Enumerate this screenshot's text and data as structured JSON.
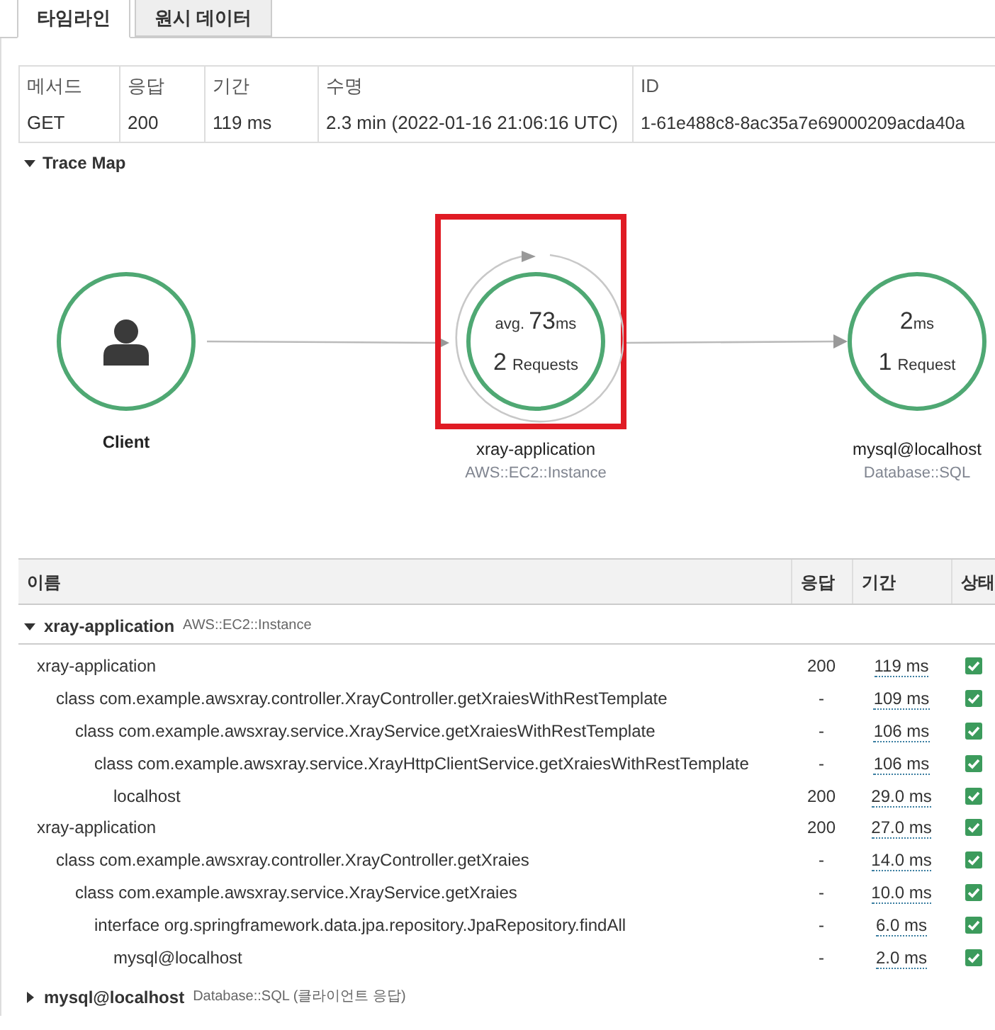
{
  "tabs": [
    {
      "label": "타임라인",
      "selected": true
    },
    {
      "label": "원시 데이터",
      "selected": false
    }
  ],
  "summary": {
    "columns": [
      "메서드",
      "응답",
      "기간",
      "수명",
      "ID"
    ],
    "values": [
      "GET",
      "200",
      "119 ms",
      "2.3 min (2022-01-16 21:06:16 UTC)",
      "1-61e488c8-8ac35a7e69000209acda40a"
    ]
  },
  "trace_map": {
    "title": "Trace Map",
    "expanded": true,
    "nodes": [
      {
        "kind": "client",
        "name": "Client"
      },
      {
        "kind": "service",
        "name": "xray-application",
        "type": "AWS::EC2::Instance",
        "prefix": "avg.",
        "value": "73",
        "unit": "ms",
        "count": "2",
        "count_label": "Requests",
        "highlighted": true,
        "loop": true
      },
      {
        "kind": "service",
        "name": "mysql@localhost",
        "type": "Database::SQL",
        "value": "2",
        "unit": "ms",
        "count": "1",
        "count_label": "Request",
        "highlighted": false,
        "loop": false
      }
    ]
  },
  "trace_table": {
    "columns": [
      "이름",
      "응답",
      "기간",
      "상태"
    ],
    "groups": [
      {
        "name": "xray-application",
        "type": "AWS::EC2::Instance",
        "expanded": true,
        "rows": [
          {
            "name": "xray-application",
            "response": "200",
            "duration": "119 ms",
            "ok": true,
            "children": [
              {
                "name": "class com.example.awsxray.controller.XrayController.getXraiesWithRestTemplate",
                "response": "-",
                "duration": "109 ms",
                "ok": true,
                "children": [
                  {
                    "name": "class com.example.awsxray.service.XrayService.getXraiesWithRestTemplate",
                    "response": "-",
                    "duration": "106 ms",
                    "ok": true,
                    "children": [
                      {
                        "name": "class com.example.awsxray.service.XrayHttpClientService.getXraiesWithRestTemplate",
                        "response": "-",
                        "duration": "106 ms",
                        "ok": true,
                        "children": [
                          {
                            "name": "localhost",
                            "response": "200",
                            "duration": "29.0 ms",
                            "ok": true
                          }
                        ]
                      }
                    ]
                  }
                ]
              }
            ]
          },
          {
            "name": "xray-application",
            "response": "200",
            "duration": "27.0 ms",
            "ok": true,
            "children": [
              {
                "name": "class com.example.awsxray.controller.XrayController.getXraies",
                "response": "-",
                "duration": "14.0 ms",
                "ok": true,
                "children": [
                  {
                    "name": "class com.example.awsxray.service.XrayService.getXraies",
                    "response": "-",
                    "duration": "10.0 ms",
                    "ok": true,
                    "children": [
                      {
                        "name": "interface org.springframework.data.jpa.repository.JpaRepository.findAll",
                        "response": "-",
                        "duration": "6.0 ms",
                        "ok": true,
                        "children": [
                          {
                            "name": "mysql@localhost",
                            "response": "-",
                            "duration": "2.0 ms",
                            "ok": true
                          }
                        ]
                      }
                    ]
                  }
                ]
              }
            ]
          }
        ]
      },
      {
        "name": "mysql@localhost",
        "type": "Database::SQL (클라이언트 응답)",
        "expanded": false
      }
    ]
  }
}
